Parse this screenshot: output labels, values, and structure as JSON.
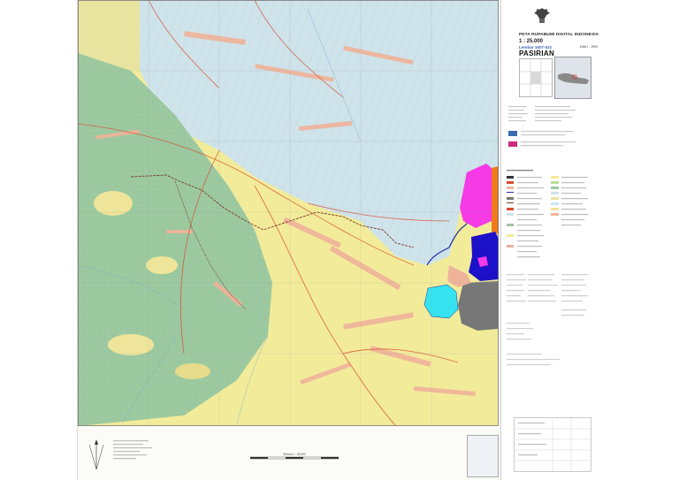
{
  "map": {
    "series_title": "PETA RUPABUMI DIGITAL INDONESIA",
    "scale": "1 : 25.000",
    "sheet_number": "Lembar 1607-531",
    "edition": "Edisi I - 1999",
    "sheet_name": "PASIRIAN",
    "scale_bar_label": "SKALA 1 : 25.000"
  },
  "legend_colors": {
    "lowland": "#cfe3ea",
    "upland": "#f2ec9a",
    "forest": "#9cc9a0",
    "settlement": "#f0b39a",
    "magenta_zone": "#f53ae6",
    "orange_zone": "#f07a1c",
    "blue_zone": "#1d10c9",
    "cyan_zone": "#35e3f0",
    "gray_zone": "#777777",
    "river": "#1b2fa8",
    "road": "#d94c2e",
    "boundary": "#7a3b2a"
  }
}
